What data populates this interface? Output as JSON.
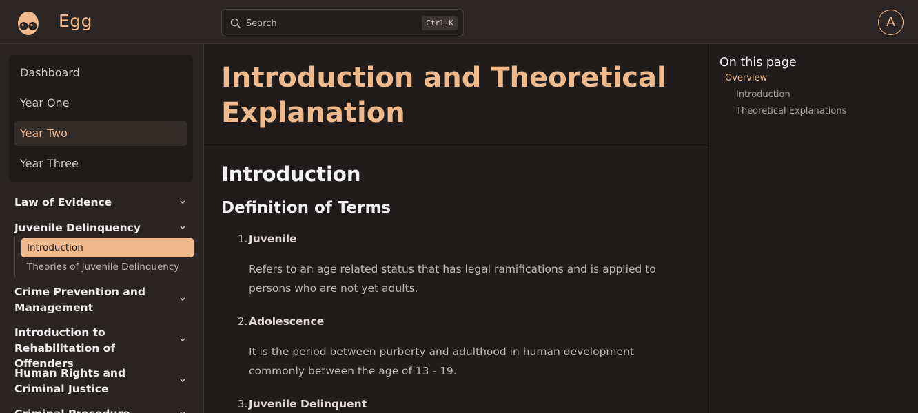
{
  "app": {
    "name": "Egg"
  },
  "search": {
    "placeholder": "Search",
    "shortcut": "Ctrl K"
  },
  "user": {
    "avatar_initial": "A"
  },
  "sidebar": {
    "nav": [
      {
        "label": "Dashboard",
        "active": false
      },
      {
        "label": "Year One",
        "active": false
      },
      {
        "label": "Year Two",
        "active": true
      },
      {
        "label": "Year Three",
        "active": false
      }
    ],
    "groups": [
      {
        "label": "Law of Evidence",
        "expanded": false
      },
      {
        "label": "Juvenile Delinquency",
        "expanded": true,
        "items": [
          {
            "label": "Introduction",
            "active": true
          },
          {
            "label": "Theories of Juvenile Delinquency",
            "active": false
          }
        ]
      },
      {
        "label": "Crime Prevention and Management",
        "expanded": false
      },
      {
        "label": "Introduction to Rehabilitation of Offenders",
        "expanded": false
      },
      {
        "label": "Human Rights and Criminal Justice",
        "expanded": false
      },
      {
        "label": "Criminal Procedure",
        "expanded": false
      }
    ]
  },
  "main": {
    "title": "Introduction and Theoretical Explanation",
    "heading": "Introduction",
    "subheading": "Definition of Terms",
    "terms": [
      {
        "number": "1.",
        "term": "Juvenile",
        "definition": "Refers to an age related status that has legal ramifications and is applied to persons who are not yet adults."
      },
      {
        "number": "2.",
        "term": "Adolescence",
        "definition": "It is the period between purberty and adulthood in human development commonly between the age of 13 - 19."
      },
      {
        "number": "3.",
        "term": "Juvenile Delinquent",
        "definition": ""
      }
    ]
  },
  "toc": {
    "title": "On this page",
    "items": [
      {
        "label": "Overview",
        "level": 1,
        "active": true
      },
      {
        "label": "Introduction",
        "level": 2,
        "active": false
      },
      {
        "label": "Theoretical Explanations",
        "level": 2,
        "active": false
      }
    ]
  },
  "colors": {
    "accent": "#f0b98b",
    "background": "#1f1c1b",
    "panel": "#2a2523"
  }
}
